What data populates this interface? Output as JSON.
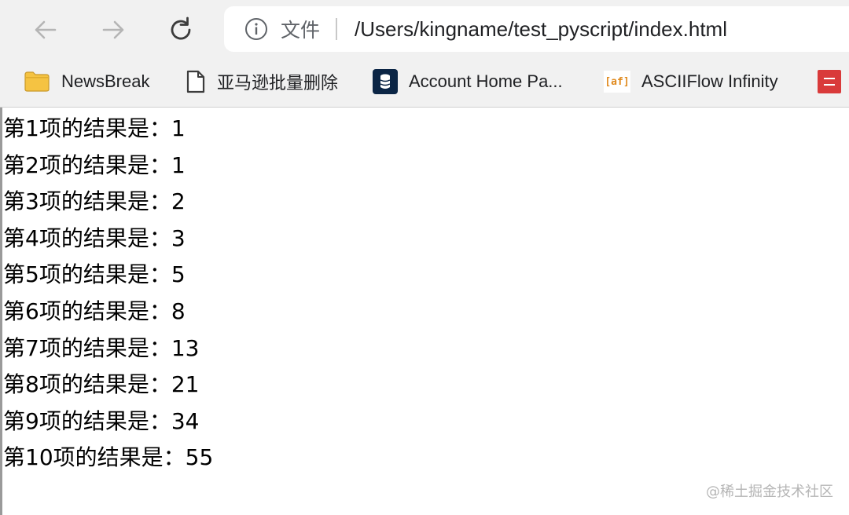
{
  "address_bar": {
    "scheme_label": "文件",
    "url": "/Users/kingname/test_pyscript/index.html"
  },
  "bookmarks": [
    {
      "label": "NewsBreak",
      "icon": "folder-icon"
    },
    {
      "label": "亚马逊批量删除",
      "icon": "page-icon"
    },
    {
      "label": "Account Home Pa...",
      "icon": "database-icon"
    },
    {
      "label": "ASCIIFlow Infinity",
      "icon": "asciiflow-icon",
      "icon_text": "[af]"
    },
    {
      "label": "",
      "icon": "red-bookmark-icon"
    }
  ],
  "results": [
    {
      "label": "第1项的结果是：",
      "value": "1"
    },
    {
      "label": "第2项的结果是：",
      "value": "1"
    },
    {
      "label": "第3项的结果是：",
      "value": "2"
    },
    {
      "label": "第4项的结果是：",
      "value": "3"
    },
    {
      "label": "第5项的结果是：",
      "value": "5"
    },
    {
      "label": "第6项的结果是：",
      "value": "8"
    },
    {
      "label": "第7项的结果是：",
      "value": "13"
    },
    {
      "label": "第8项的结果是：",
      "value": "21"
    },
    {
      "label": "第9项的结果是：",
      "value": "34"
    },
    {
      "label": "第10项的结果是：",
      "value": "55"
    }
  ],
  "watermark": "@稀土掘金技术社区",
  "colors": {
    "toolbar_bg": "#f1f1f1",
    "folder_yellow": "#f5c342",
    "database_navy": "#0b2545",
    "red_bookmark": "#d93a3a"
  }
}
